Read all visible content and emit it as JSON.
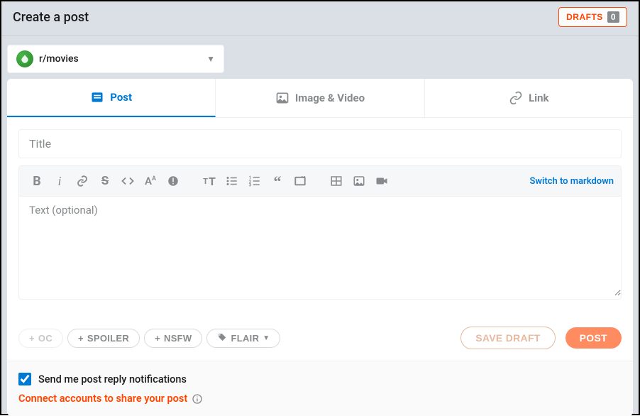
{
  "header": {
    "title": "Create a post",
    "drafts_label": "DRAFTS",
    "drafts_count": "0"
  },
  "community": {
    "name": "r/movies"
  },
  "tabs": {
    "post": "Post",
    "image": "Image & Video",
    "link": "Link",
    "active": "post"
  },
  "editor": {
    "title_placeholder": "Title",
    "title_value": "",
    "body_placeholder": "Text (optional)",
    "body_value": "",
    "markdown_link": "Switch to markdown"
  },
  "tags": {
    "oc": "OC",
    "spoiler": "SPOILER",
    "nsfw": "NSFW",
    "flair": "FLAIR"
  },
  "actions": {
    "save_draft": "SAVE DRAFT",
    "post": "POST"
  },
  "footer": {
    "notify_label": "Send me post reply notifications",
    "notify_checked": true,
    "connect_label": "Connect accounts to share your post"
  },
  "colors": {
    "accent": "#0079d3",
    "orange": "#ff4500"
  }
}
